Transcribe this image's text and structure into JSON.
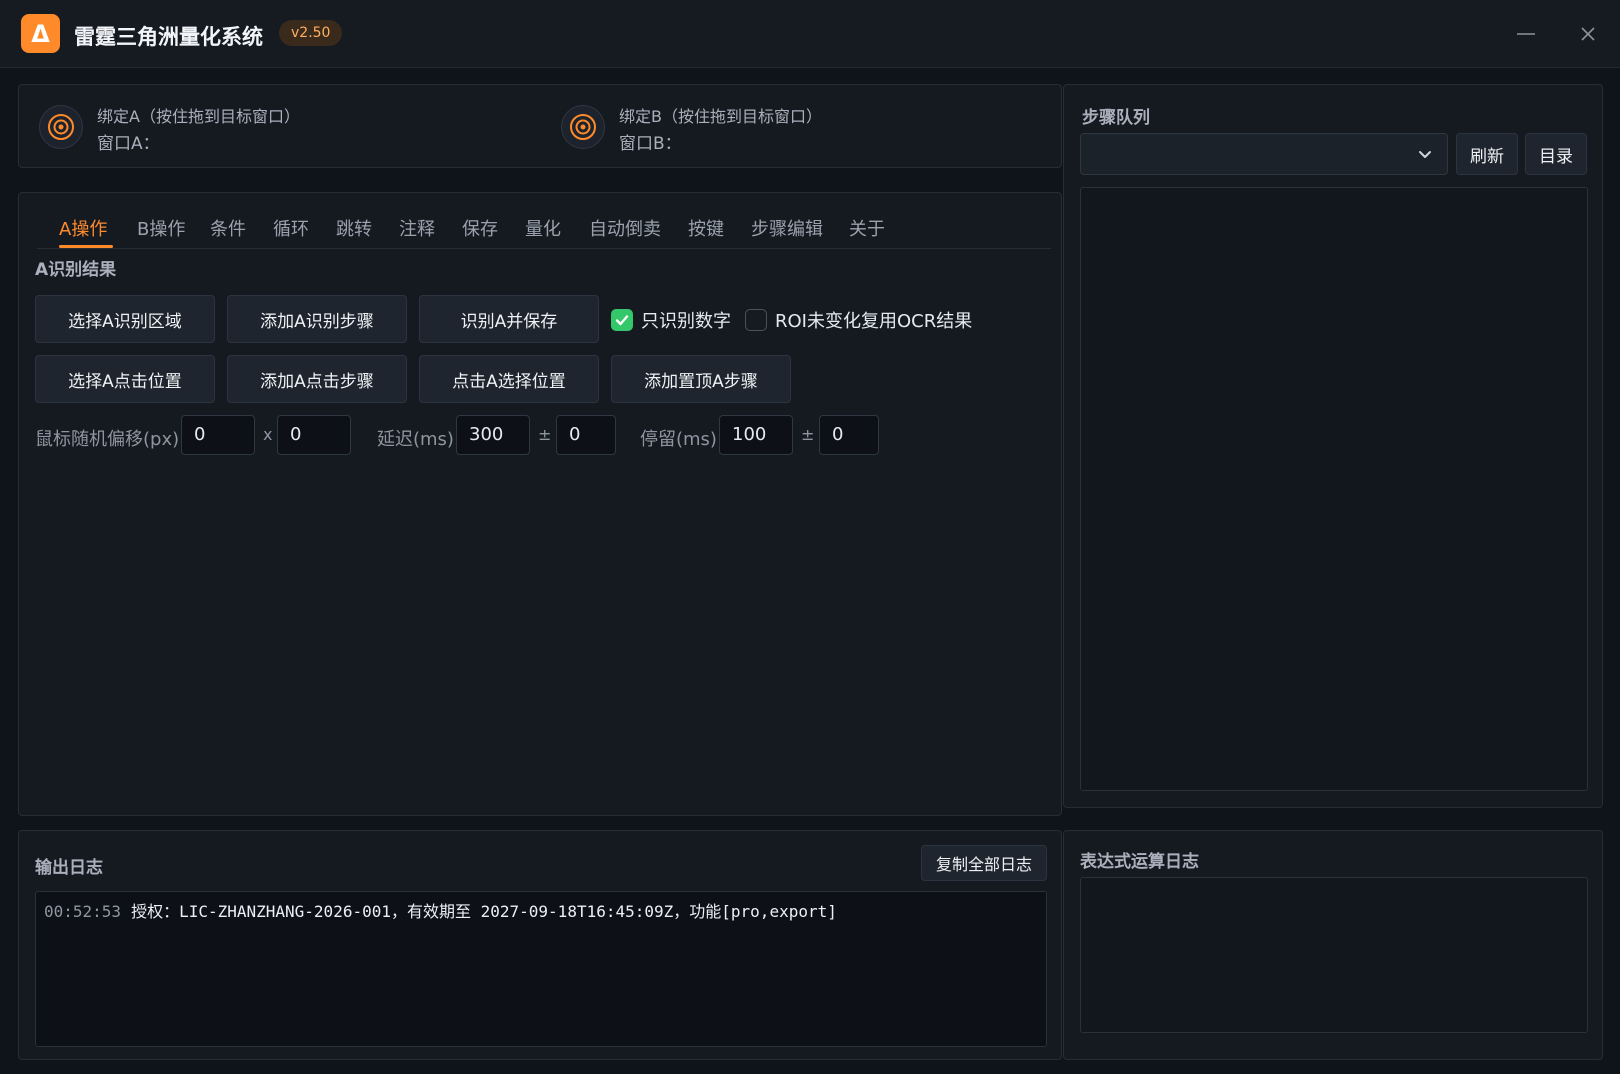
{
  "app": {
    "title": "雷霆三角洲量化系统",
    "version": "v2.50",
    "logo_glyph": "Δ",
    "accent_color": "#ff8a2a"
  },
  "bind": {
    "a": {
      "label": "绑定A（按住拖到目标窗口）",
      "window": "窗口A："
    },
    "b": {
      "label": "绑定B（按住拖到目标窗口）",
      "window": "窗口B："
    }
  },
  "tabs": [
    "A操作",
    "B操作",
    "条件",
    "循环",
    "跳转",
    "注释",
    "保存",
    "量化",
    "自动倒卖",
    "按键",
    "步骤编辑",
    "关于"
  ],
  "main": {
    "section_title": "A识别结果",
    "buttons_row1": [
      "选择A识别区域",
      "添加A识别步骤",
      "识别A并保存"
    ],
    "buttons_row2": [
      "选择A点击位置",
      "添加A点击步骤",
      "点击A选择位置",
      "添加置顶A步骤"
    ],
    "check_digits": {
      "label": "只识别数字",
      "checked": true
    },
    "check_roi": {
      "label": "ROI未变化复用OCR结果",
      "checked": false
    },
    "offset": {
      "label": "鼠标随机偏移(px)",
      "x": "0",
      "sep": "x",
      "y": "0"
    },
    "delay": {
      "label": "延迟(ms)",
      "value": "300",
      "pm": "±",
      "jitter": "0"
    },
    "stay": {
      "label": "停留(ms)",
      "value": "100",
      "pm": "±",
      "jitter": "0"
    }
  },
  "queue": {
    "title": "步骤队列",
    "refresh": "刷新",
    "directory": "目录"
  },
  "log": {
    "title": "输出日志",
    "copy_all": "复制全部日志",
    "entries": [
      {
        "time": "00:52:53",
        "message": "授权：LIC-ZHANZHANG-2026-001，有效期至 2027-09-18T16:45:09Z，功能[pro,export]"
      }
    ]
  },
  "expr_log": {
    "title": "表达式运算日志"
  }
}
